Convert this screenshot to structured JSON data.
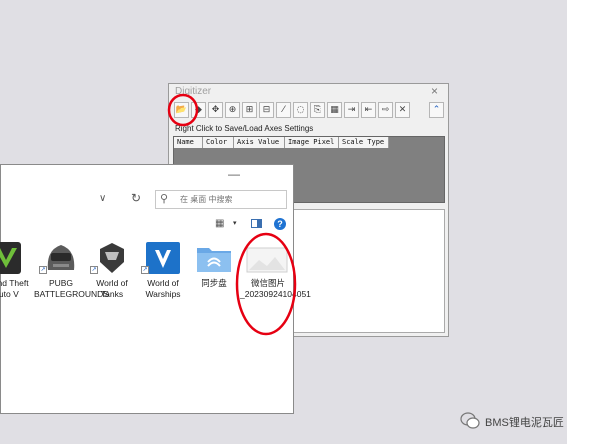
{
  "digitizer": {
    "title": "Digitizer",
    "close_glyph": "×",
    "hint": "Right Click to Save/Load Axes Settings",
    "toolbar": [
      {
        "name": "open-file-icon",
        "glyph": "📂"
      },
      {
        "name": "palette-icon",
        "glyph": "◆"
      },
      {
        "name": "calibrate-icon",
        "glyph": "✥"
      },
      {
        "name": "axis-point-icon",
        "glyph": "⊕"
      },
      {
        "name": "add-point-icon",
        "glyph": "⊞"
      },
      {
        "name": "move-point-icon",
        "glyph": "⊟"
      },
      {
        "name": "magic-wand-icon",
        "glyph": "⁄"
      },
      {
        "name": "eraser-icon",
        "glyph": "◌"
      },
      {
        "name": "copy-icon",
        "glyph": "⎘"
      },
      {
        "name": "grid-icon",
        "glyph": "▦"
      },
      {
        "name": "arrow-right-icon",
        "glyph": "⇥"
      },
      {
        "name": "arrow-left-icon",
        "glyph": "⇤"
      },
      {
        "name": "export-icon",
        "glyph": "⇨"
      },
      {
        "name": "clear-icon",
        "glyph": "✕"
      },
      {
        "name": "collapse-icon",
        "glyph": "⌃"
      }
    ],
    "columns": [
      "Name",
      "Color",
      "Axis Value",
      "Image Pixel",
      "Scale Type"
    ]
  },
  "explorer": {
    "minimize_glyph": "—",
    "chevron_glyph": "∨",
    "refresh_glyph": "↻",
    "search_icon": "⚲",
    "search_placeholder": "在 桌面 中搜索",
    "view_glyph": "▦",
    "view_arrow": "▾",
    "help_glyph": "?",
    "files": [
      {
        "label": "Grand Theft Auto V",
        "icon": "gta-v-icon"
      },
      {
        "label": "PUBG BATTLEGROUNDS",
        "icon": "pubg-icon"
      },
      {
        "label": "World of Tanks",
        "icon": "world-of-tanks-icon"
      },
      {
        "label": "World of Warships",
        "icon": "world-of-warships-icon"
      },
      {
        "label": "同步盘",
        "icon": "sync-folder-icon"
      },
      {
        "label": "微信图片_20230924104051",
        "icon": "image-file-icon"
      }
    ]
  },
  "watermark": {
    "text": "BMS锂电泥瓦匠"
  },
  "colors": {
    "annotation_red": "#e60012",
    "desktop_bg": "#e0dfe4",
    "table_grey": "#808080"
  }
}
